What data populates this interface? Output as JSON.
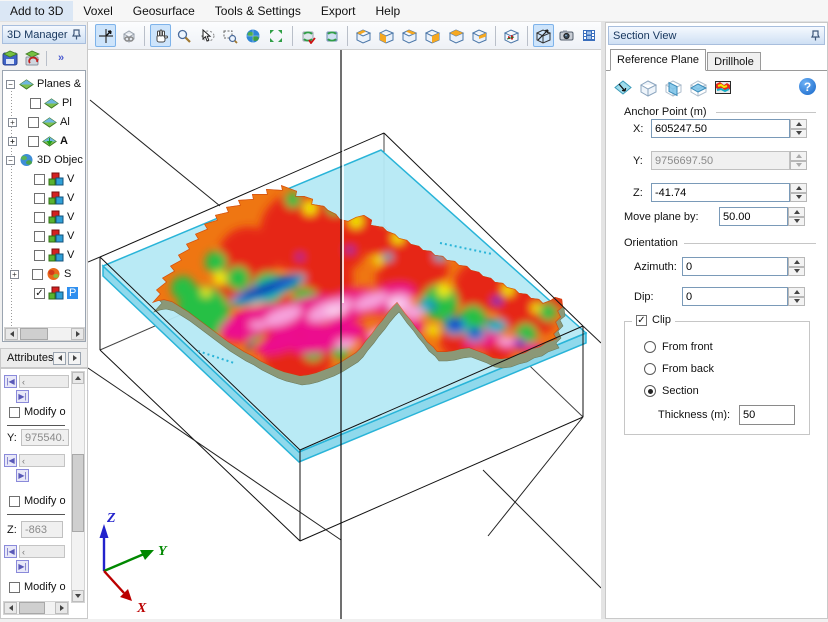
{
  "menubar": {
    "items": [
      "Add to 3D",
      "Voxel",
      "Geosurface",
      "Tools & Settings",
      "Export",
      "Help"
    ]
  },
  "left_panel": {
    "title": "3D Manager",
    "overflow_chevron": "»",
    "tree_items": [
      {
        "label": "Planes &"
      },
      {
        "label": "Pl"
      },
      {
        "label": "Al"
      },
      {
        "label": "A"
      },
      {
        "label": "3D Objec"
      },
      {
        "label": "V"
      },
      {
        "label": "V"
      },
      {
        "label": "V"
      },
      {
        "label": "V"
      },
      {
        "label": "V"
      },
      {
        "label": "S"
      },
      {
        "label": "P"
      }
    ],
    "attributes": {
      "title": "Attributes",
      "modify_label": "Modify o",
      "y_label": "Y:",
      "y_value": "975540.",
      "z_label": "Z:",
      "z_value": "-863"
    }
  },
  "toolbar": {
    "buttons": [
      "track-plane-cursor",
      "link-views",
      "pan-hand",
      "zoom-magnifier",
      "select-cursor",
      "zoom-box",
      "full-view-globe",
      "fit-to-extents",
      "refresh-database",
      "update-viewed-data",
      "view-corner-nw",
      "view-front-face",
      "view-corner-ne",
      "view-left-face",
      "view-top-face",
      "view-corner-se",
      "axes-box",
      "section-tool",
      "snapshot-camera",
      "movie"
    ],
    "selected": [
      "track-plane-cursor",
      "pan-hand",
      "section-tool"
    ]
  },
  "right_panel": {
    "title": "Section View",
    "tabs": [
      {
        "label": "Reference Plane"
      },
      {
        "label": "Drillhole"
      }
    ],
    "active_tab": "Reference Plane",
    "tools": [
      "flip-plane",
      "box-faces",
      "vertical-plane",
      "horizontal-plane",
      "active-section"
    ],
    "anchor": {
      "legend": "Anchor Point (m)",
      "x_label": "X:",
      "x_value": "605247.50",
      "y_label": "Y:",
      "y_value": "9756697.50",
      "z_label": "Z:",
      "z_value": "-41.74",
      "move_label": "Move plane by:",
      "move_value": "50.00"
    },
    "orientation": {
      "legend": "Orientation",
      "azimuth_label": "Azimuth:",
      "azimuth_value": "0",
      "dip_label": "Dip:",
      "dip_value": "0"
    },
    "clip": {
      "legend": "Clip",
      "option_front": "From front",
      "option_back": "From back",
      "option_section": "Section",
      "selected": "Section",
      "thickness_label": "Thickness (m):",
      "thickness_value": "50"
    }
  },
  "viewport": {
    "axes": {
      "x": "X",
      "y": "Y",
      "z": "Z"
    },
    "colors": {
      "section_plane": "#b5e9f4",
      "section_edge": "#29b4d8",
      "axis_x": "#bb0000",
      "axis_y": "#008800",
      "axis_z": "#2222cc",
      "selection": "#2f8fef"
    }
  }
}
